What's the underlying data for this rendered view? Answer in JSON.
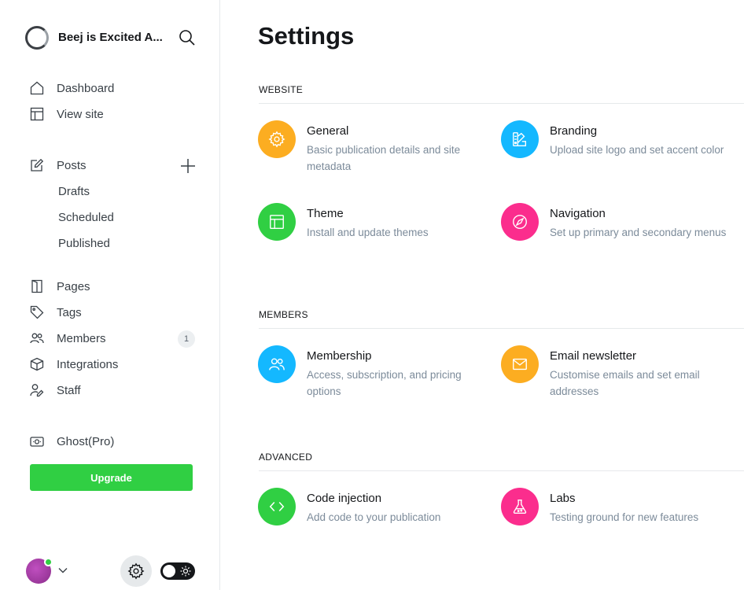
{
  "sidebar": {
    "site_title": "Beej is Excited A...",
    "nav": {
      "dashboard": "Dashboard",
      "view_site": "View site",
      "posts": "Posts",
      "drafts": "Drafts",
      "scheduled": "Scheduled",
      "published": "Published",
      "pages": "Pages",
      "tags": "Tags",
      "members": "Members",
      "members_count": "1",
      "integrations": "Integrations",
      "staff": "Staff",
      "ghost_pro": "Ghost(Pro)"
    },
    "upgrade_label": "Upgrade"
  },
  "main": {
    "title": "Settings",
    "sections": {
      "website": "WEBSITE",
      "members": "MEMBERS",
      "advanced": "ADVANCED"
    },
    "cards": {
      "general": {
        "title": "General",
        "desc": "Basic publication details and site metadata",
        "color": "#fcad21",
        "icon": "gear-icon"
      },
      "branding": {
        "title": "Branding",
        "desc": "Upload site logo and set accent color",
        "color": "#14b8ff",
        "icon": "palette-icon"
      },
      "theme": {
        "title": "Theme",
        "desc": "Install and update themes",
        "color": "#30cf43",
        "icon": "layout-icon"
      },
      "navigation": {
        "title": "Navigation",
        "desc": "Set up primary and secondary menus",
        "color": "#fb2d8d",
        "icon": "compass-icon"
      },
      "membership": {
        "title": "Membership",
        "desc": "Access, subscription, and pricing options",
        "color": "#14b8ff",
        "icon": "members-icon"
      },
      "email_newsletter": {
        "title": "Email newsletter",
        "desc": "Customise emails and set email addresses",
        "color": "#fcad21",
        "icon": "envelope-icon"
      },
      "code_injection": {
        "title": "Code injection",
        "desc": "Add code to your publication",
        "color": "#30cf43",
        "icon": "code-icon"
      },
      "labs": {
        "title": "Labs",
        "desc": "Testing ground for new features",
        "color": "#fb2d8d",
        "icon": "flask-icon"
      }
    }
  },
  "colors": {
    "accent_green": "#30cf43",
    "text_dark": "#15171a",
    "text_muted": "#7c8b9a"
  }
}
